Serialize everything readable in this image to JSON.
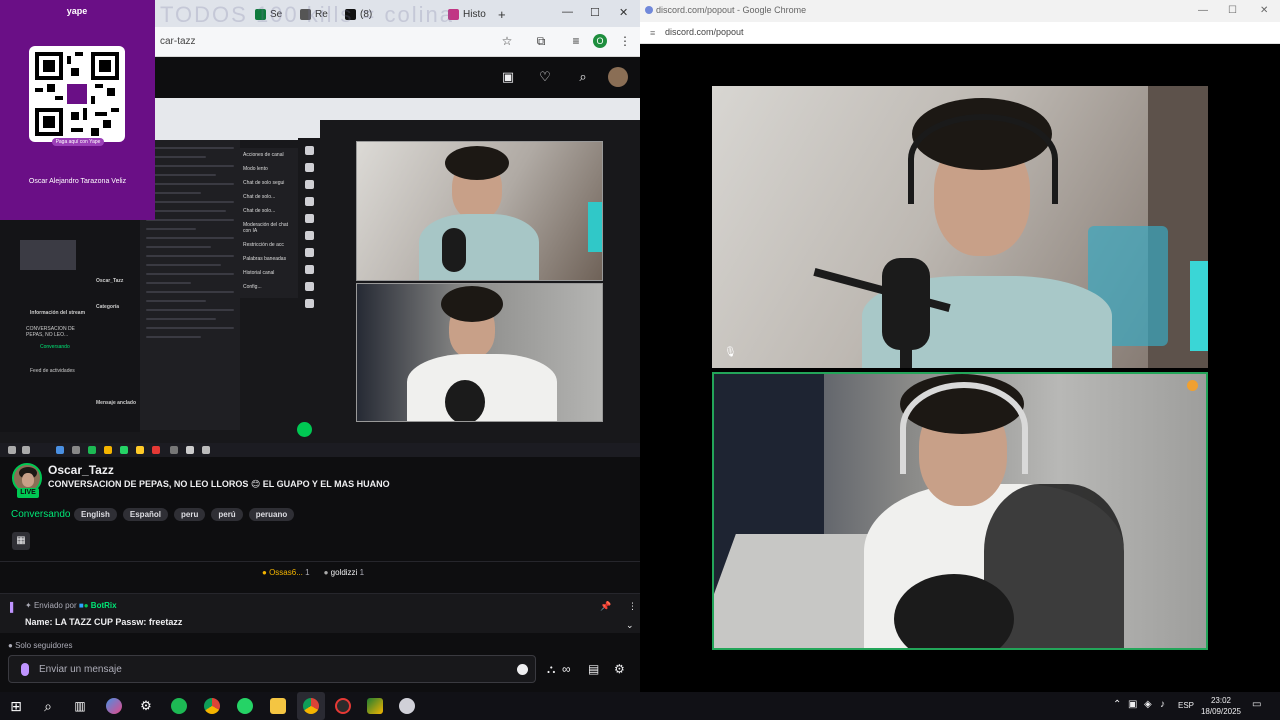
{
  "left_window": {
    "tabs": [
      {
        "label": "Se",
        "color": "#0f7a3d"
      },
      {
        "label": "Re",
        "color": "#333"
      },
      {
        "label": "(8)",
        "color": "#111"
      },
      {
        "label": "Histo",
        "color": "#c13584"
      }
    ],
    "new_tab_label": "+",
    "address": "car-tazz",
    "watermark": "TODOS 100 kills = colina",
    "profile_initial": "O"
  },
  "yape": {
    "logo": "yape",
    "note": "Paga aquí con Yape",
    "name": "Oscar Alejandro Tarazona Veliz"
  },
  "stream": {
    "streamer": "Oscar_Tazz",
    "live_label": "LIVE",
    "title": "CONVERSACION DE PEPAS, NO LEO LLOROS 😊 EL GUAPO Y EL MAS HUANO",
    "category": "Conversando",
    "tags": [
      "English",
      "Español",
      "peru",
      "perú",
      "peruano"
    ]
  },
  "leaderboard": [
    {
      "name": "Ossas6...",
      "count": "1"
    },
    {
      "name": "goldizzi",
      "count": "1"
    }
  ],
  "pinned": {
    "prefix": "Enviado por",
    "bot": "BotRix",
    "message": "Name: LA TAZZ CUP Passw: freetazz"
  },
  "chat": {
    "followers_only": "Solo seguidores",
    "placeholder": "Enviar un mensaje"
  },
  "nested": {
    "menu": [
      "Acciones de canal",
      "Modo lento",
      "Chat de solo segui",
      "Chat de solo...",
      "Chat de solo...",
      "Moderación del chat con IA",
      "Restricción de acc",
      "Palabras baneadas",
      "Historial canal",
      "Config..."
    ],
    "left_labels": [
      "Información del stream",
      "CONVERSACION DE PEPAS, NO LEO...",
      "Conversando",
      "Feed de actividades",
      "Oscar_Tazz",
      "Categoría",
      "Mensaje anclado"
    ]
  },
  "right_window": {
    "title": "discord.com/popout - Google Chrome",
    "url": "discord.com/popout"
  },
  "taskbar": {
    "lang": "ESP",
    "time": "23:02",
    "date": "18/09/2025"
  },
  "colors": {
    "twitch_green": "#00c853",
    "discord_speaking": "#23a559",
    "yape_purple": "#6a0f86"
  }
}
